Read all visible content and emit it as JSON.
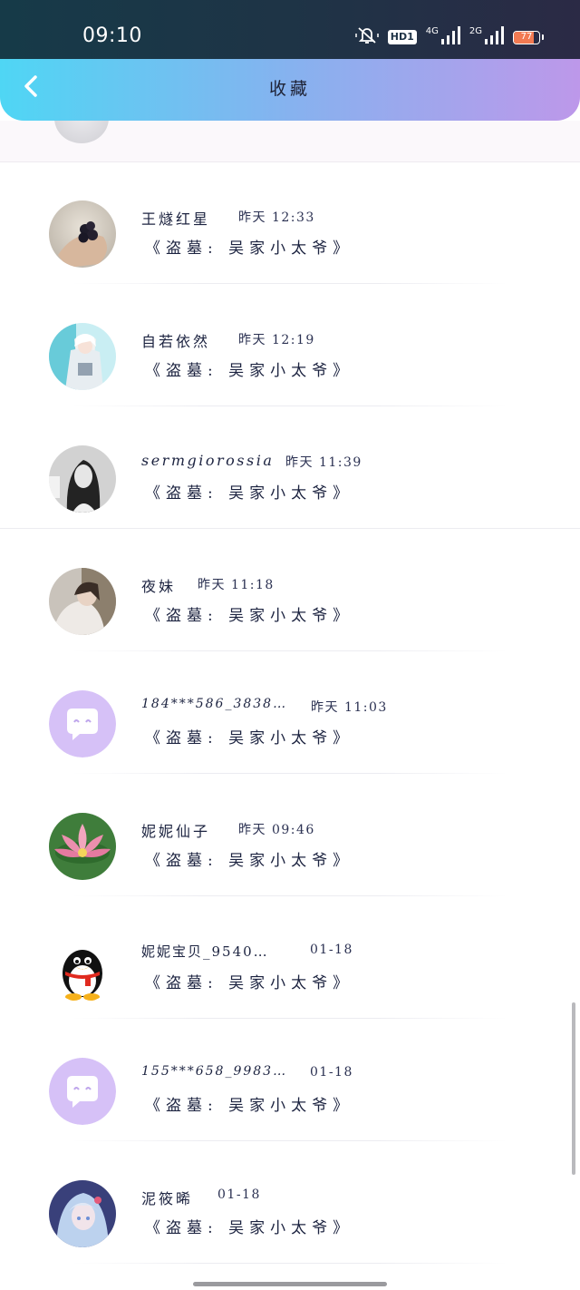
{
  "status_bar": {
    "time": "09:10",
    "hd_label": "HD1",
    "network_4g": "4G",
    "network_2g": "2G",
    "battery_level": "77",
    "battery_fraction": 0.77,
    "icons": [
      "mute-icon",
      "hd-icon",
      "signal-4g-icon",
      "signal-2g-icon",
      "battery-icon"
    ]
  },
  "header": {
    "title": "收藏",
    "back_icon": "chevron-left-icon",
    "gradient": [
      "#4fd6f4",
      "#bd98ea"
    ]
  },
  "favorites": [
    {
      "name": "王燧红星",
      "time": "昨天 12:33",
      "subtitle": "《盗墓: 吴家小太爷》",
      "avatar": "blackberry-hand"
    },
    {
      "name": "自若依然",
      "time": "昨天 12:19",
      "subtitle": "《盗墓: 吴家小太爷》",
      "avatar": "anime-character-teal"
    },
    {
      "name": "sermgiorossia",
      "time": "昨天 11:39",
      "subtitle": "《盗墓: 吴家小太爷》",
      "avatar": "girl-portrait-bw"
    },
    {
      "name": "夜妹",
      "time": "昨天 11:18",
      "subtitle": "《盗墓: 吴家小太爷》",
      "avatar": "girl-photo"
    },
    {
      "name": "184***586_3838…",
      "time": "昨天 11:03",
      "subtitle": "《盗墓: 吴家小太爷》",
      "avatar": "default-chat-bubble"
    },
    {
      "name": "妮妮仙子",
      "time": "昨天 09:46",
      "subtitle": "《盗墓: 吴家小太爷》",
      "avatar": "lotus-flower"
    },
    {
      "name": "妮妮宝贝_9540…",
      "time": "01-18",
      "subtitle": "《盗墓: 吴家小太爷》",
      "avatar": "qq-penguin"
    },
    {
      "name": "155***658_9983…",
      "time": "01-18",
      "subtitle": "《盗墓: 吴家小太爷》",
      "avatar": "default-chat-bubble"
    },
    {
      "name": "泥筱晞",
      "time": "01-18",
      "subtitle": "《盗墓: 吴家小太爷》",
      "avatar": "anime-girl-blue"
    }
  ],
  "colors": {
    "status_bar": "#1f3346",
    "default_avatar_bg": "#d6c1f7",
    "text": "#1c2340"
  }
}
